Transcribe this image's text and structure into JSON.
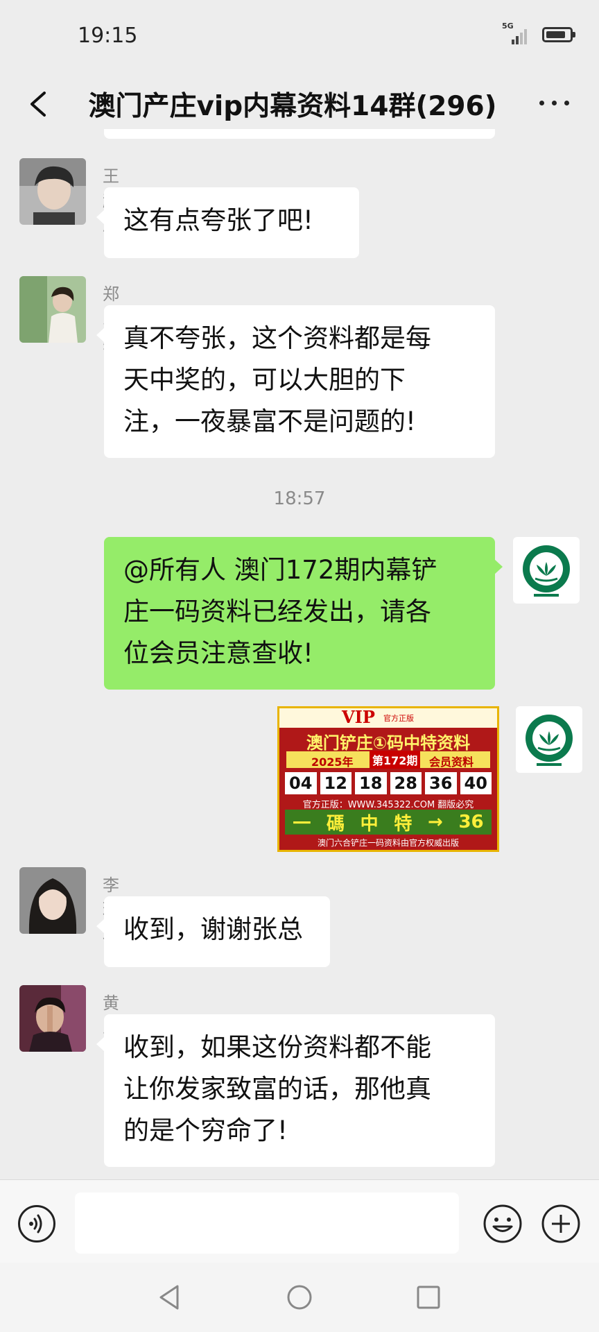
{
  "status_bar": {
    "time": "19:15",
    "network": "5G",
    "battery_level": 0.85
  },
  "header": {
    "title": "澳门产庄vip内幕资料14群(296)",
    "back_icon": "chevron-left-icon",
    "more_icon": "more-dots-icon"
  },
  "messages": [
    {
      "sender": "王起凤",
      "side": "left",
      "lines": [
        "这有点夸张了吧!"
      ]
    },
    {
      "sender": "郑恩英",
      "side": "left",
      "lines": [
        "真不夸张，这个资料都是每",
        "天中奖的，可以大胆的下",
        "注，一夜暴富不是问题的!"
      ]
    },
    {
      "timestamp": "18:57"
    },
    {
      "side": "right",
      "lines": [
        "@所有人 澳门172期内幕铲",
        "庄一码资料已经发出，请各",
        "位会员注意查收!"
      ]
    },
    {
      "side": "right",
      "type": "image",
      "image": {
        "vip": "VIP",
        "official": "官方正版",
        "main_title": "澳门铲庄①码中特资料",
        "year": "2025年",
        "period": "第172期",
        "member": "会员资料",
        "numbers": [
          "04",
          "12",
          "18",
          "28",
          "36",
          "40"
        ],
        "site": "官方正版：WWW.345322.COM 翻版必究",
        "bottom_chars": [
          "一",
          "碼",
          "中",
          "特",
          "→",
          "36"
        ],
        "footer": "澳门六合铲庄一码资料由官方权威出版"
      }
    },
    {
      "sender": "李珊珊",
      "side": "left",
      "lines": [
        "收到，谢谢张总"
      ]
    },
    {
      "sender": "黄总",
      "side": "left",
      "lines": [
        "收到，如果这份资料都不能",
        "让你发家致富的话，那他真",
        "的是个穷命了!"
      ]
    }
  ],
  "input_bar": {
    "voice_icon": "voice-icon",
    "input_value": "",
    "emoji_icon": "emoji-icon",
    "plus_icon": "plus-icon"
  },
  "nav_bar": {
    "back_icon": "nav-back-icon",
    "home_icon": "nav-home-icon",
    "recent_icon": "nav-recent-icon"
  },
  "colors": {
    "background": "#ededed",
    "bubble_left": "#ffffff",
    "bubble_right": "#95ec69",
    "sender_name": "#8c8c8c"
  }
}
